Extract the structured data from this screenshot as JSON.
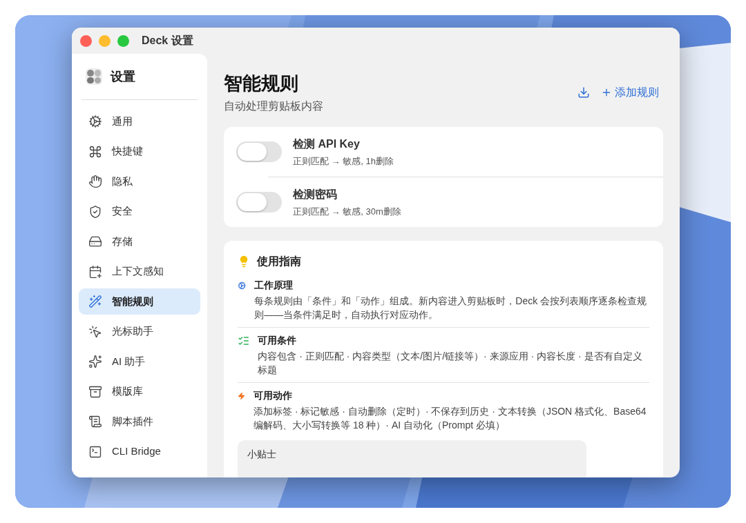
{
  "window": {
    "title": "Deck 设置"
  },
  "sidebar": {
    "title": "设置",
    "items": [
      {
        "label": "通用",
        "selected": false
      },
      {
        "label": "快捷键",
        "selected": false
      },
      {
        "label": "隐私",
        "selected": false
      },
      {
        "label": "安全",
        "selected": false
      },
      {
        "label": "存储",
        "selected": false
      },
      {
        "label": "上下文感知",
        "selected": false
      },
      {
        "label": "智能规则",
        "selected": true
      },
      {
        "label": "光标助手",
        "selected": false
      },
      {
        "label": "AI 助手",
        "selected": false
      },
      {
        "label": "模版库",
        "selected": false
      },
      {
        "label": "脚本插件",
        "selected": false
      },
      {
        "label": "CLI Bridge",
        "selected": false
      }
    ]
  },
  "header": {
    "title": "智能规则",
    "subtitle": "自动处理剪贴板内容",
    "add_button": "添加规则"
  },
  "rules": [
    {
      "name": "检测 API Key",
      "summary": "正则匹配 → 敏感, 1h删除",
      "on": false
    },
    {
      "name": "检测密码",
      "summary": "正则匹配 → 敏感, 30m删除",
      "on": false
    }
  ],
  "guide": {
    "title": "使用指南",
    "sections": [
      {
        "kind": "gears",
        "title": "工作原理",
        "text": "每条规则由「条件」和「动作」组成。新内容进入剪贴板时，Deck 会按列表顺序逐条检查规则——当条件满足时，自动执行对应动作。"
      },
      {
        "kind": "list",
        "title": "可用条件",
        "text": "内容包含 · 正则匹配 · 内容类型（文本/图片/链接等）· 来源应用 · 内容长度 · 是否有自定义标题"
      },
      {
        "kind": "bolt",
        "title": "可用动作",
        "text": "添加标签 · 标记敏感 · 自动删除（定时）· 不保存到历史 · 文本转换（JSON 格式化、Base64 编解码、大小写转换等 18 种）· AI 自动化（Prompt 必填）"
      }
    ],
    "tip_title": "小贴士"
  }
}
